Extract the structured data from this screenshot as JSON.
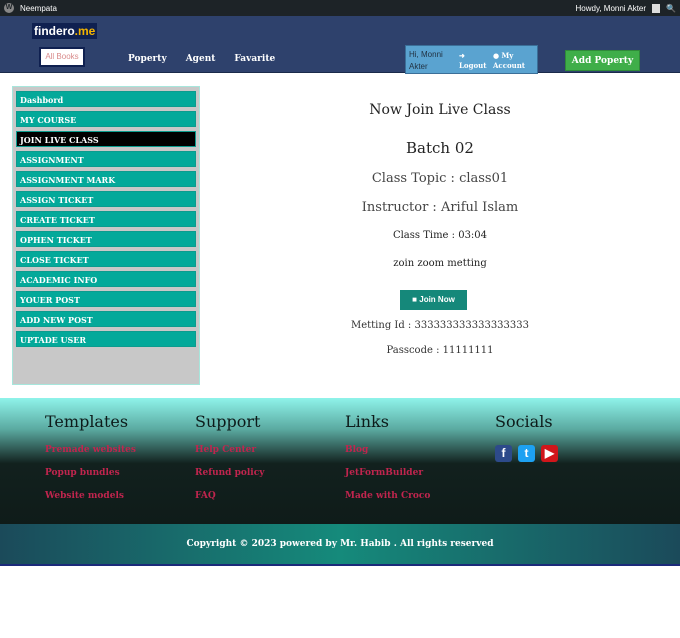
{
  "adminbar": {
    "site": "Neempata",
    "howdy": "Howdy, Monni Akter"
  },
  "header": {
    "logo_main": "findero",
    "logo_accent": ".me",
    "all_books": "All Books",
    "nav": [
      "Poperty",
      "Agent",
      "Favarite"
    ],
    "greeting": "Hi, Monni Akter",
    "logout": "Logout",
    "my_account": "My Account",
    "add_property": "Add Poperty"
  },
  "sidebar": {
    "items": [
      "Dashbord",
      "MY COURSE",
      "JOIN LIVE CLASS",
      "ASSIGNMENT",
      "ASSIGNMENT MARK",
      "ASSIGN TICKET",
      "CREATE TICKET",
      "OPHEN TICKET",
      "CLOSE TICKET",
      "ACADEMIC INFO",
      "YOUER POST",
      "ADD NEW POST",
      "UPTADE USER"
    ],
    "active": 2
  },
  "main": {
    "title": "Now Join Live Class",
    "batch": "Batch 02",
    "topic": "Class Topic : class01",
    "instructor": "Instructor : Ariful Islam",
    "time": "Class Time : 03:04",
    "platform": "zoin zoom metting",
    "join": "Join Now",
    "meeting_id": "Metting Id : 333333333333333333",
    "passcode": "Passcode : 11111111"
  },
  "footer": {
    "columns": [
      {
        "title": "Templates",
        "links": [
          "Premade websites",
          "Popup bundles",
          "Website models"
        ]
      },
      {
        "title": "Support",
        "links": [
          "Help Center",
          "Refund policy",
          "FAQ"
        ]
      },
      {
        "title": "Links",
        "links": [
          "Blog",
          "JetFormBuilder",
          "Made with Croco"
        ]
      }
    ],
    "socials_title": "Socials",
    "socials": [
      "facebook-icon",
      "twitter-icon",
      "youtube-icon"
    ],
    "copyright": "Copyright © 2023 powered by Mr. Habib . All rights reserved"
  }
}
